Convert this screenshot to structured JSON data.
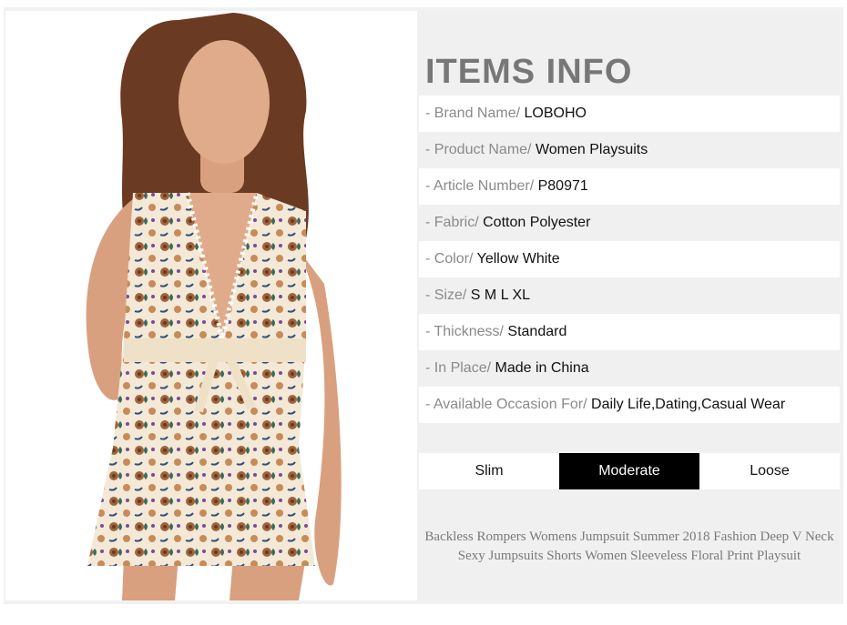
{
  "info": {
    "title": "ITEMS INFO",
    "rows": [
      {
        "label": "- Brand Name/ ",
        "value": "LOBOHO"
      },
      {
        "label": "- Product Name/ ",
        "value": "Women Playsuits"
      },
      {
        "label": "- Article Number/ ",
        "value": "P80971"
      },
      {
        "label": "- Fabric/ ",
        "value": "Cotton Polyester"
      },
      {
        "label": "- Color/ ",
        "value": "Yellow White"
      },
      {
        "label": "- Size/ ",
        "value": "S M L XL"
      },
      {
        "label": "- Thickness/ ",
        "value": "Standard"
      },
      {
        "label": "- In Place/ ",
        "value": "Made in China"
      },
      {
        "label": "- Available Occasion For/ ",
        "value": "Daily Life,Dating,Casual Wear"
      }
    ],
    "fit": {
      "options": [
        "Slim",
        "Moderate",
        "Loose"
      ],
      "selected": "Moderate"
    },
    "description_line1": "Backless Rompers Womens Jumpsuit Summer 2018 Fashion Deep V Neck",
    "description_line2": "Sexy Jumpsuits Shorts Women Sleeveless Floral Print Playsuit"
  },
  "colors": {
    "title": "#777777",
    "label": "#8a8a8a",
    "value": "#111111",
    "selected_bg": "#000000",
    "selected_text": "#ffffff",
    "skin": "#d9a07f",
    "hair": "#6b3a22",
    "fabric": "#f3e9d6"
  }
}
